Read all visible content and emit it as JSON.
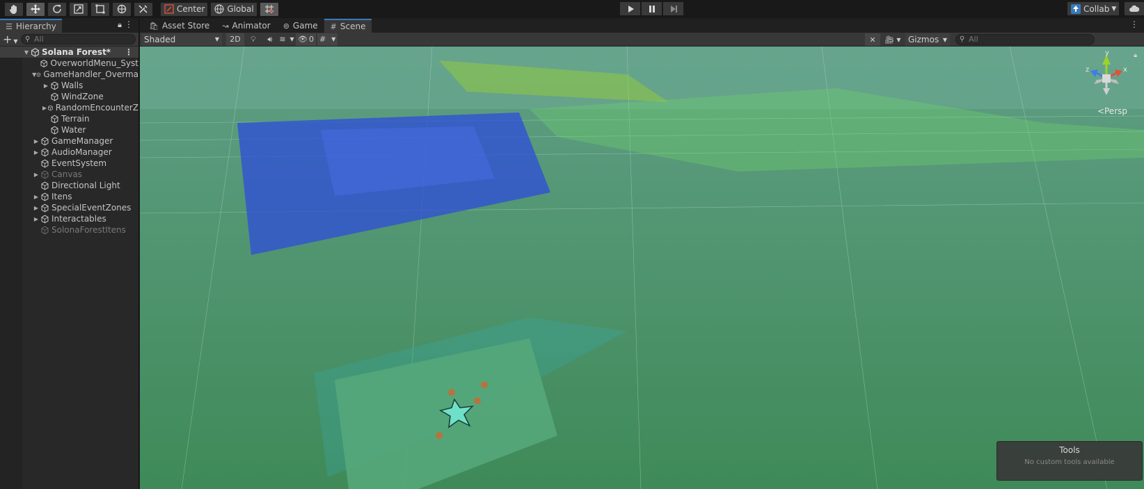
{
  "toolbar": {
    "pivot_label": "Center",
    "space_label": "Global",
    "collab_label": "Collab"
  },
  "hierarchy": {
    "tab_label": "Hierarchy",
    "search_placeholder": "All",
    "scene_name": "Solana Forest*",
    "items": [
      {
        "label": "OverworldMenu_Syst",
        "depth": 1,
        "expand": false,
        "dim": false
      },
      {
        "label": "GameHandler_Overma",
        "depth": 1,
        "expand": "open",
        "dim": false
      },
      {
        "label": "Walls",
        "depth": 2,
        "expand": "closed",
        "dim": false
      },
      {
        "label": "WindZone",
        "depth": 2,
        "expand": false,
        "dim": false
      },
      {
        "label": "RandomEncounterZ",
        "depth": 2,
        "expand": "closed",
        "dim": false
      },
      {
        "label": "Terrain",
        "depth": 2,
        "expand": false,
        "dim": false
      },
      {
        "label": "Water",
        "depth": 2,
        "expand": false,
        "dim": false
      },
      {
        "label": "GameManager",
        "depth": 1,
        "expand": "closed",
        "dim": false
      },
      {
        "label": "AudioManager",
        "depth": 1,
        "expand": "closed",
        "dim": false
      },
      {
        "label": "EventSystem",
        "depth": 1,
        "expand": false,
        "dim": false
      },
      {
        "label": "Canvas",
        "depth": 1,
        "expand": "closed",
        "dim": true
      },
      {
        "label": "Directional Light",
        "depth": 1,
        "expand": false,
        "dim": false
      },
      {
        "label": "Itens",
        "depth": 1,
        "expand": "closed",
        "dim": false
      },
      {
        "label": "SpecialEventZones",
        "depth": 1,
        "expand": "closed",
        "dim": false
      },
      {
        "label": "Interactables",
        "depth": 1,
        "expand": "closed",
        "dim": false
      },
      {
        "label": "SolonaForestItens",
        "depth": 1,
        "expand": false,
        "dim": true
      }
    ]
  },
  "scene_tabs": {
    "asset_store": "Asset Store",
    "animator": "Animator",
    "game": "Game",
    "scene": "Scene"
  },
  "scene_toolbar": {
    "shading_mode": "Shaded",
    "mode_2d": "2D",
    "hidden_count": "0",
    "gizmos_label": "Gizmos",
    "search_placeholder": "All"
  },
  "viewport": {
    "projection_label": "Persp",
    "axis_x": "x",
    "axis_y": "y",
    "axis_z": "z",
    "tools_title": "Tools",
    "tools_subtitle": "No custom tools available"
  },
  "colors": {
    "accent": "#3a79bb",
    "axis_x": "#e0523c",
    "axis_y": "#9bd12e",
    "axis_z": "#3e7ee6"
  }
}
